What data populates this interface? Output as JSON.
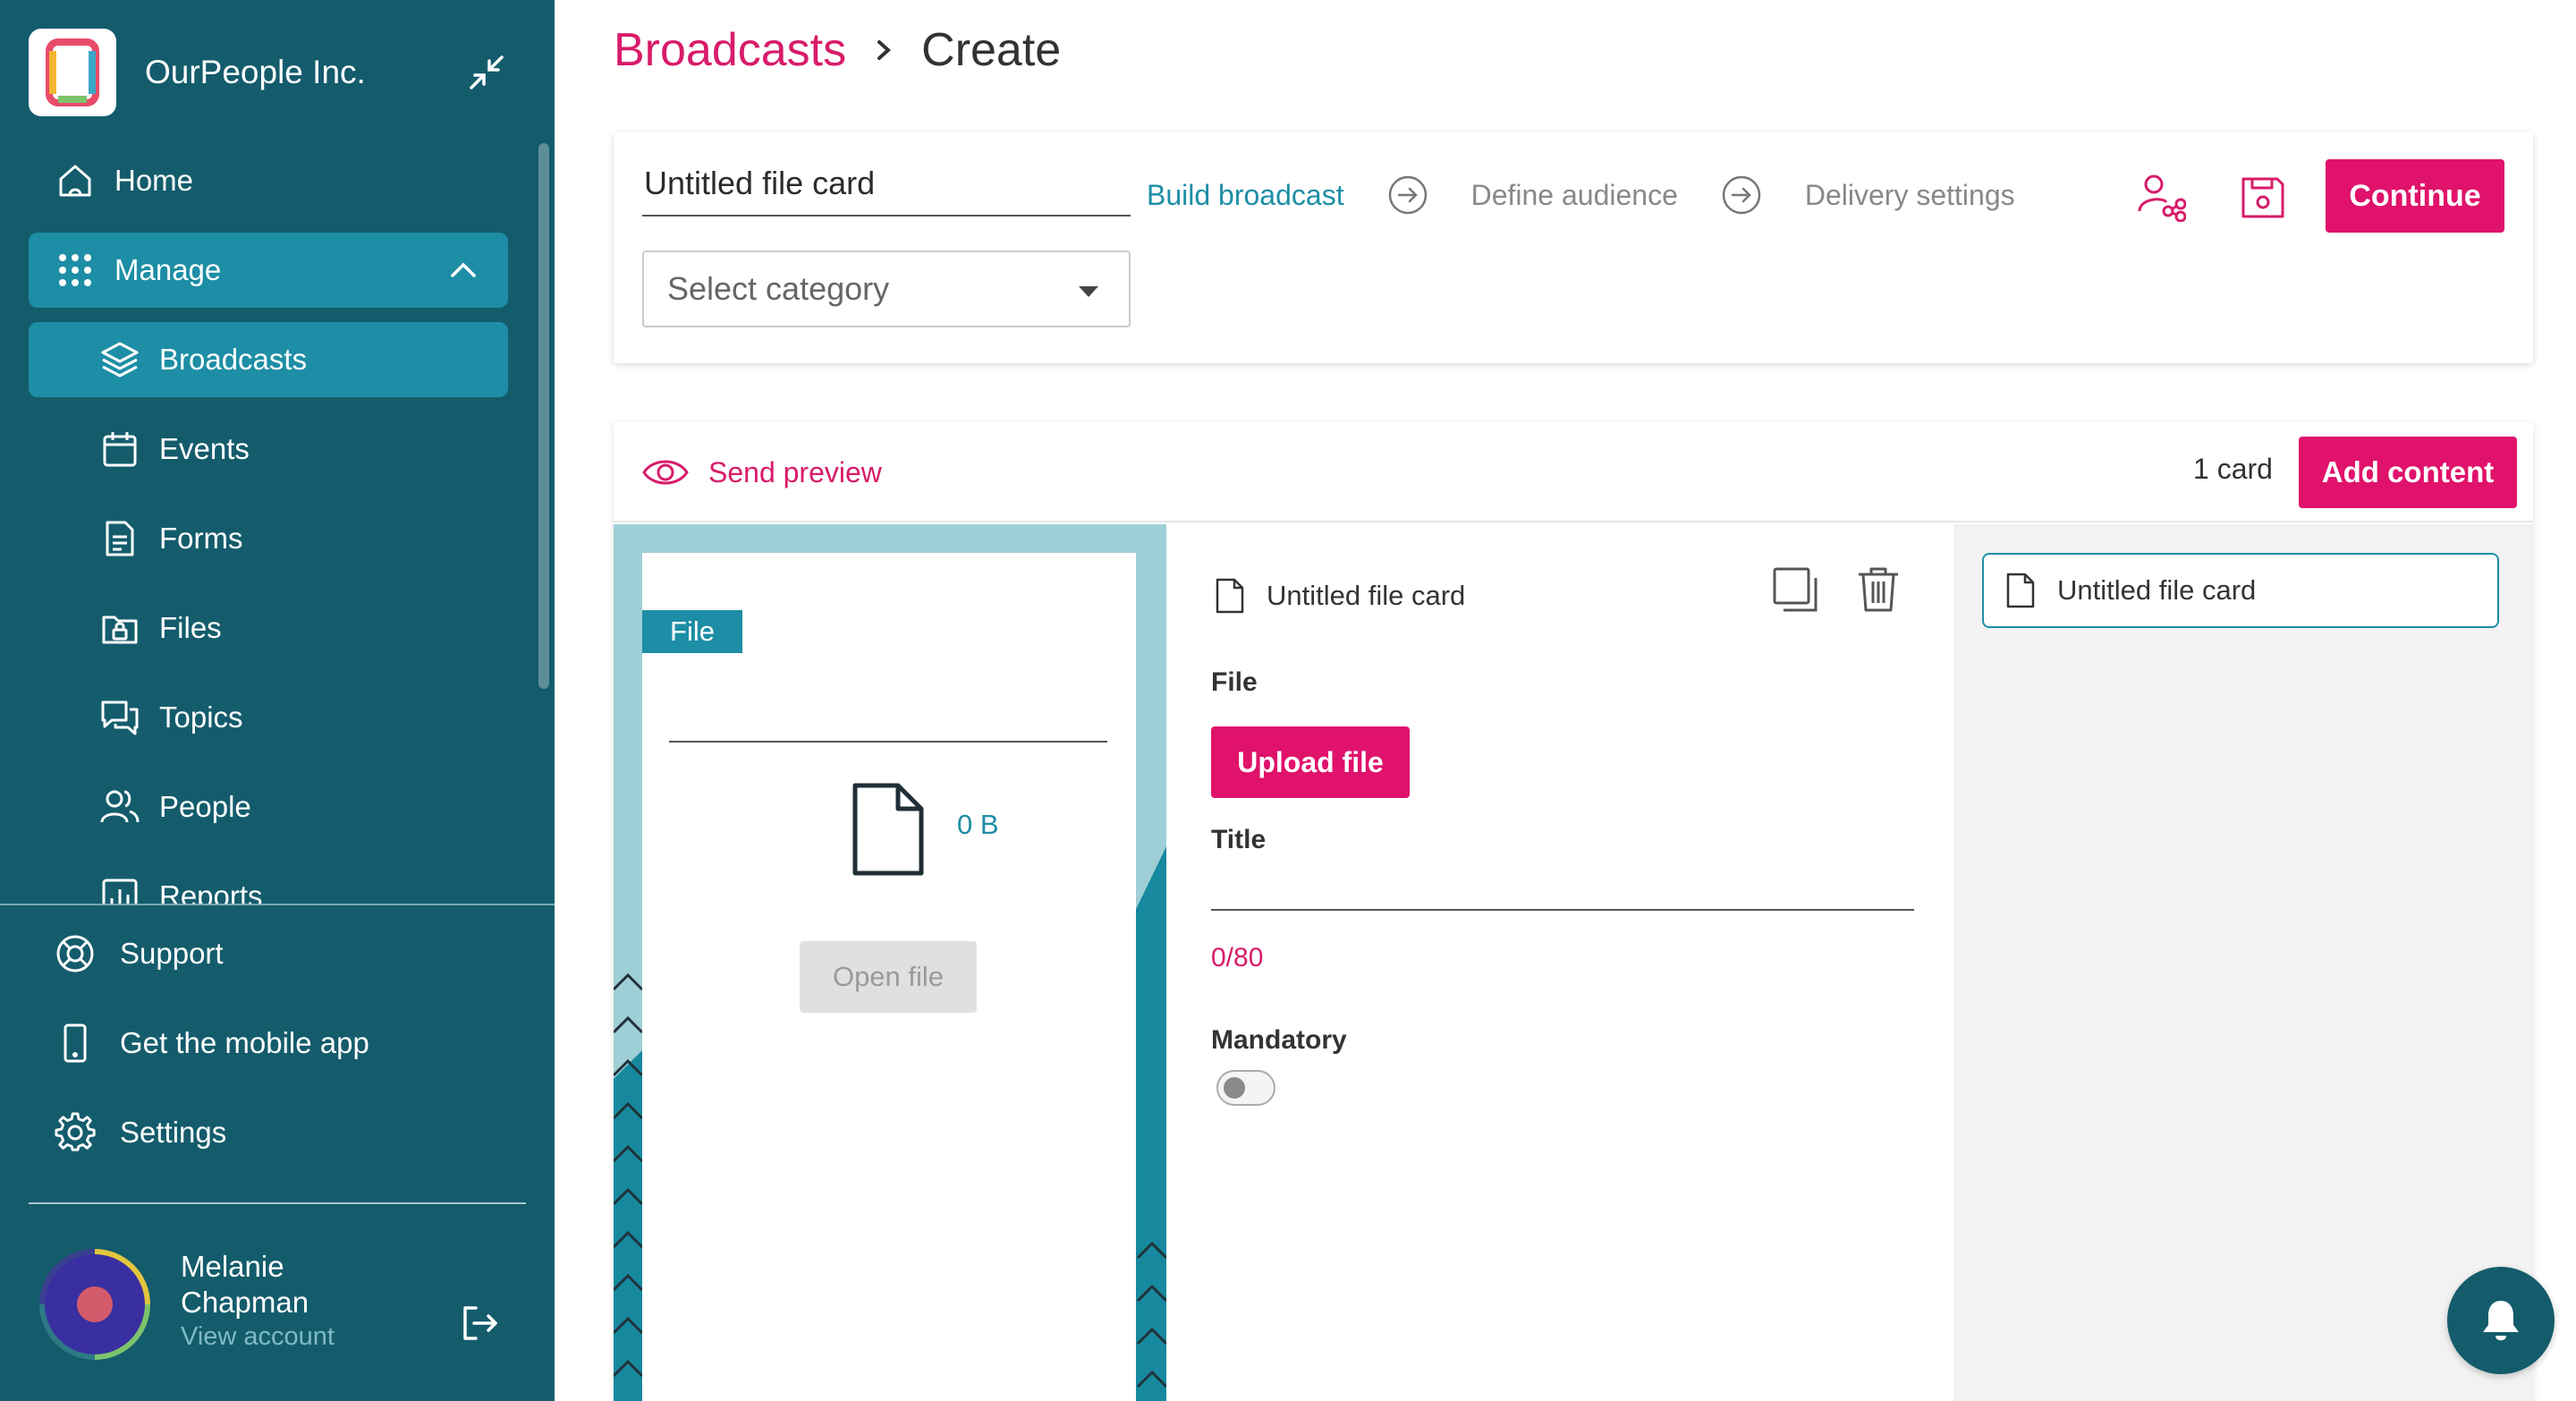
{
  "org": {
    "name": "OurPeople Inc."
  },
  "sidebar": {
    "manage_label": "Manage",
    "items": [
      {
        "label": "Home",
        "icon": "home-icon"
      },
      {
        "label": "Broadcasts",
        "icon": "layers-icon"
      },
      {
        "label": "Events",
        "icon": "calendar-icon"
      },
      {
        "label": "Forms",
        "icon": "form-icon"
      },
      {
        "label": "Files",
        "icon": "folder-lock-icon"
      },
      {
        "label": "Topics",
        "icon": "chat-icon"
      },
      {
        "label": "People",
        "icon": "people-icon"
      },
      {
        "label": "Reports",
        "icon": "chart-icon"
      }
    ],
    "bottom_items": [
      {
        "label": "Support",
        "icon": "lifebuoy-icon"
      },
      {
        "label": "Get the mobile app",
        "icon": "phone-icon"
      },
      {
        "label": "Settings",
        "icon": "gear-icon"
      }
    ],
    "account": {
      "name": "Melanie Chapman",
      "link": "View account"
    }
  },
  "breadcrumb": {
    "root": "Broadcasts",
    "current": "Create"
  },
  "builder": {
    "title_value": "Untitled file card",
    "category_placeholder": "Select category",
    "steps": [
      "Build broadcast",
      "Define audience",
      "Delivery settings"
    ],
    "continue_label": "Continue"
  },
  "editor": {
    "send_preview_label": "Send preview",
    "card_count": "1 card",
    "add_content_label": "Add content",
    "preview": {
      "badge": "File",
      "file_size": "0 B",
      "open_file_label": "Open file"
    },
    "form": {
      "card_title": "Untitled file card",
      "file_label": "File",
      "upload_label": "Upload file",
      "title_label": "Title",
      "title_value": "",
      "char_count": "0/80",
      "mandatory_label": "Mandatory",
      "mandatory_on": false
    },
    "outline": {
      "items": [
        "Untitled file card"
      ]
    }
  },
  "colors": {
    "sidebar": "#145c6c",
    "sidebar_active": "#1d8ea5",
    "accent": "#e0126b",
    "teal_text": "#1d8ea5"
  }
}
